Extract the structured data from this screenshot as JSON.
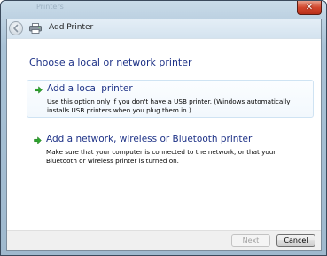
{
  "window": {
    "title": "Add Printer",
    "background_title": "Printers",
    "close_glyph": "✕"
  },
  "icons": {
    "back": "back-arrow-icon",
    "printer": "printer-icon",
    "option_arrow": "green-arrow-icon",
    "close": "close-icon"
  },
  "main": {
    "heading": "Choose a local or network printer",
    "options": [
      {
        "title": "Add a local printer",
        "description": "Use this option only if you don't have a USB printer. (Windows automatically installs USB printers when you plug them in.)"
      },
      {
        "title": "Add a network, wireless or Bluetooth printer",
        "description": "Make sure that your computer is connected to the network, or that your Bluetooth or wireless printer is turned on."
      }
    ]
  },
  "footer": {
    "next_label": "Next",
    "cancel_label": "Cancel"
  },
  "colors": {
    "heading": "#1e3287",
    "arrow": "#2ea52e",
    "close_button": "#d2462c"
  }
}
